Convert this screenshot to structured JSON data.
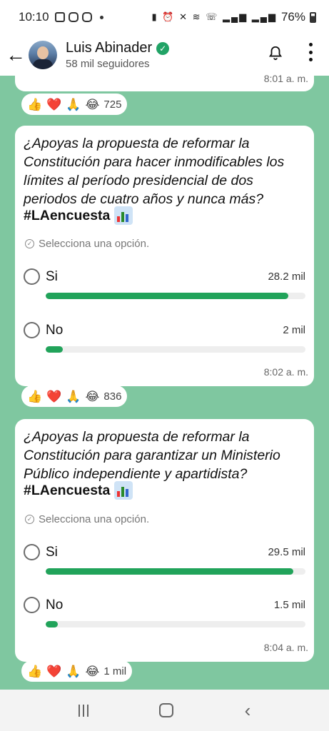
{
  "status_bar": {
    "time": "10:10",
    "battery": "76%"
  },
  "header": {
    "name": "Luis Abinader",
    "followers": "58 mil seguidores"
  },
  "top_message": {
    "time": "8:01 a. m."
  },
  "reactions_1": {
    "emojis": [
      "👍",
      "❤️",
      "🙏",
      "😂"
    ],
    "count": "725"
  },
  "poll_1": {
    "question": "¿Apoyas la propuesta de reformar la Constitución para hacer inmodificables los límites al período presidencial de dos periodos de cuatro años y nunca más?",
    "hashtag": "#LAencuesta",
    "hint": "Selecciona una opción.",
    "options": [
      {
        "label": "Si",
        "count": "28.2 mil",
        "share": 0.934
      },
      {
        "label": "No",
        "count": "2 mil",
        "share": 0.066
      }
    ],
    "time": "8:02 a. m."
  },
  "reactions_2": {
    "emojis": [
      "👍",
      "❤️",
      "🙏",
      "😂"
    ],
    "count": "836"
  },
  "poll_2": {
    "question": "¿Apoyas la propuesta de reformar la Constitución para garantizar un Ministerio Público independiente y apartidista?",
    "hashtag": "#LAencuesta",
    "hint": "Selecciona una opción.",
    "options": [
      {
        "label": "Si",
        "count": "29.5 mil",
        "share": 0.952
      },
      {
        "label": "No",
        "count": "1.5 mil",
        "share": 0.048
      }
    ],
    "time": "8:04 a. m."
  },
  "reactions_3": {
    "emojis": [
      "👍",
      "❤️",
      "🙏",
      "😂"
    ],
    "count": "1 mil"
  },
  "colors": {
    "accent": "#21a35a",
    "background": "#7fc7a0",
    "verified": "#21a366"
  }
}
